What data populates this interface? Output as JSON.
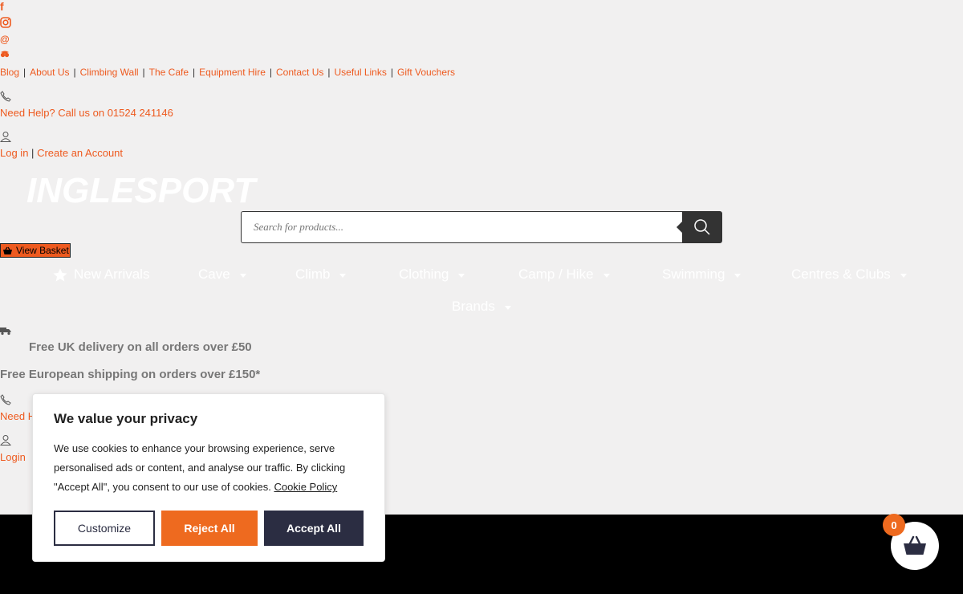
{
  "social": {
    "facebook": "f",
    "instagram": "instagram-icon",
    "email": "@",
    "tripadvisor": "tripadvisor-icon"
  },
  "top_links": [
    "Blog",
    "About Us",
    "Climbing Wall",
    "The Cafe",
    "Equipment Hire",
    "Contact Us",
    "Useful Links",
    "Gift Vouchers"
  ],
  "help": {
    "text": "Need Help? Call us on 01524 241146"
  },
  "account": {
    "login": "Log in",
    "separator": "|",
    "create": "Create an Account"
  },
  "logo": {
    "text": "INGLESPORT"
  },
  "search": {
    "placeholder": "Search for products..."
  },
  "basket": {
    "label": "View Basket"
  },
  "nav": {
    "new_arrivals": "New Arrivals",
    "cave": "Cave",
    "climb": "Climb",
    "clothing": "Clothing",
    "camp_hike": "Camp / Hike",
    "swimming": "Swimming",
    "centres_clubs": "Centres & Clubs",
    "brands": "Brands"
  },
  "delivery": {
    "uk": "Free UK delivery on all orders over £50",
    "europe": "Free European shipping on orders over £150*"
  },
  "lower": {
    "help_partial": "Need H",
    "login": "Login"
  },
  "cookie": {
    "title": "We value your privacy",
    "text": "We use cookies to enhance your browsing experience, serve personalised ads or content, and analyse our traffic. By clicking \"Accept All\", you consent to our use of cookies.",
    "policy_link": "Cookie Policy",
    "customize": "Customize",
    "reject": "Reject All",
    "accept": "Accept All"
  },
  "cart": {
    "count": "0"
  },
  "colors": {
    "accent": "#ee5a1f",
    "dark": "#2b2d42",
    "bg": "#f1f0f0"
  }
}
